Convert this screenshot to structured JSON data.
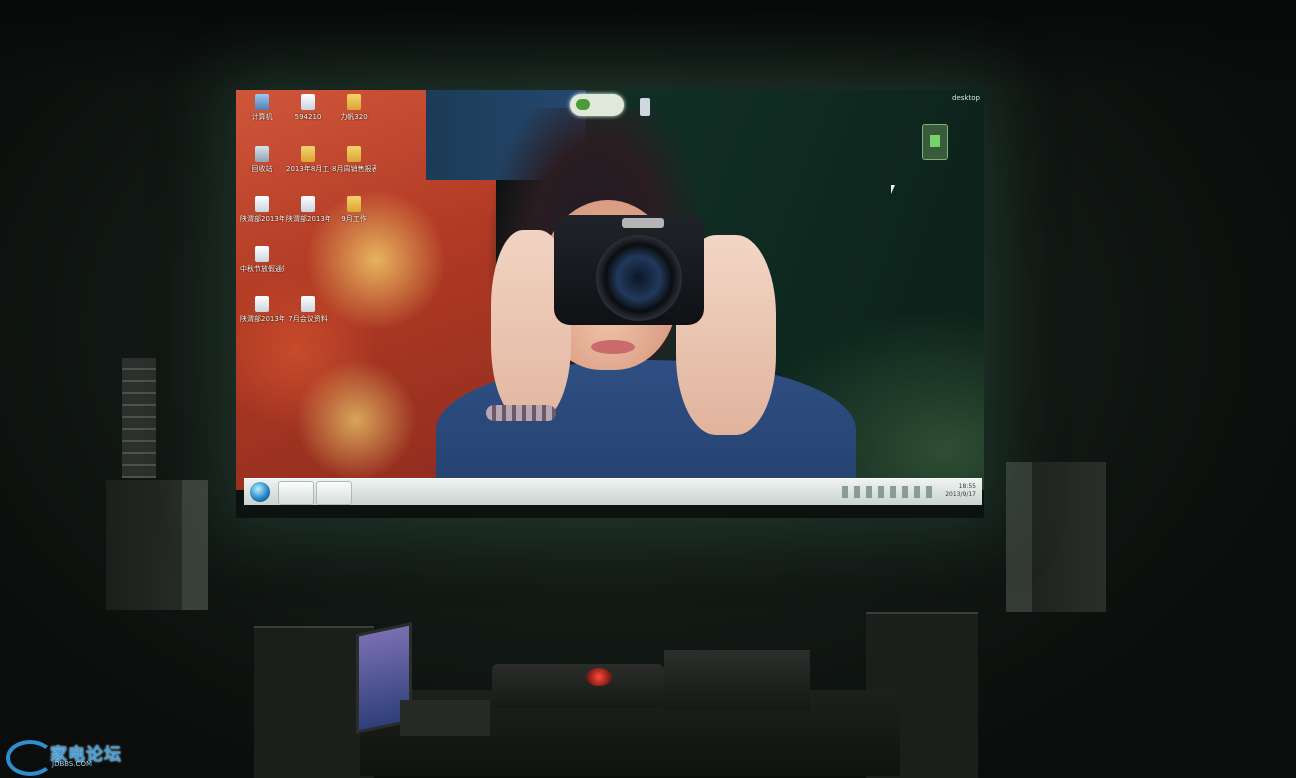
{
  "scene": {
    "projected_desktop": {
      "icons": [
        {
          "label": "计算机",
          "type": "computer"
        },
        {
          "label": "594210",
          "type": "doc"
        },
        {
          "label": "力帆320",
          "type": "folder"
        },
        {
          "label": "回收站",
          "type": "bin"
        },
        {
          "label": "2013年8月工作",
          "type": "folder"
        },
        {
          "label": "8月周销售报表",
          "type": "folder"
        },
        {
          "label": "陕渭部2013年小型促销...",
          "type": "doc"
        },
        {
          "label": "陕渭部2013年经营专项...",
          "type": "doc"
        },
        {
          "label": "9月工作",
          "type": "folder"
        },
        {
          "label": "中秋节放假通知",
          "type": "doc"
        },
        {
          "label": "陕渭部2013年1-12月...",
          "type": "doc"
        },
        {
          "label": "7月会议资料",
          "type": "doc"
        }
      ],
      "top_right_text": "desktop",
      "taskbar": {
        "clock_time": "18:55",
        "clock_date": "2013/9/17"
      }
    },
    "watermark": {
      "chinese": "家电论坛",
      "english": "JDBBS.COM"
    },
    "colors": {
      "watermark_blue": "#3aa0e2",
      "projector_led": "#ff4a3a"
    }
  }
}
